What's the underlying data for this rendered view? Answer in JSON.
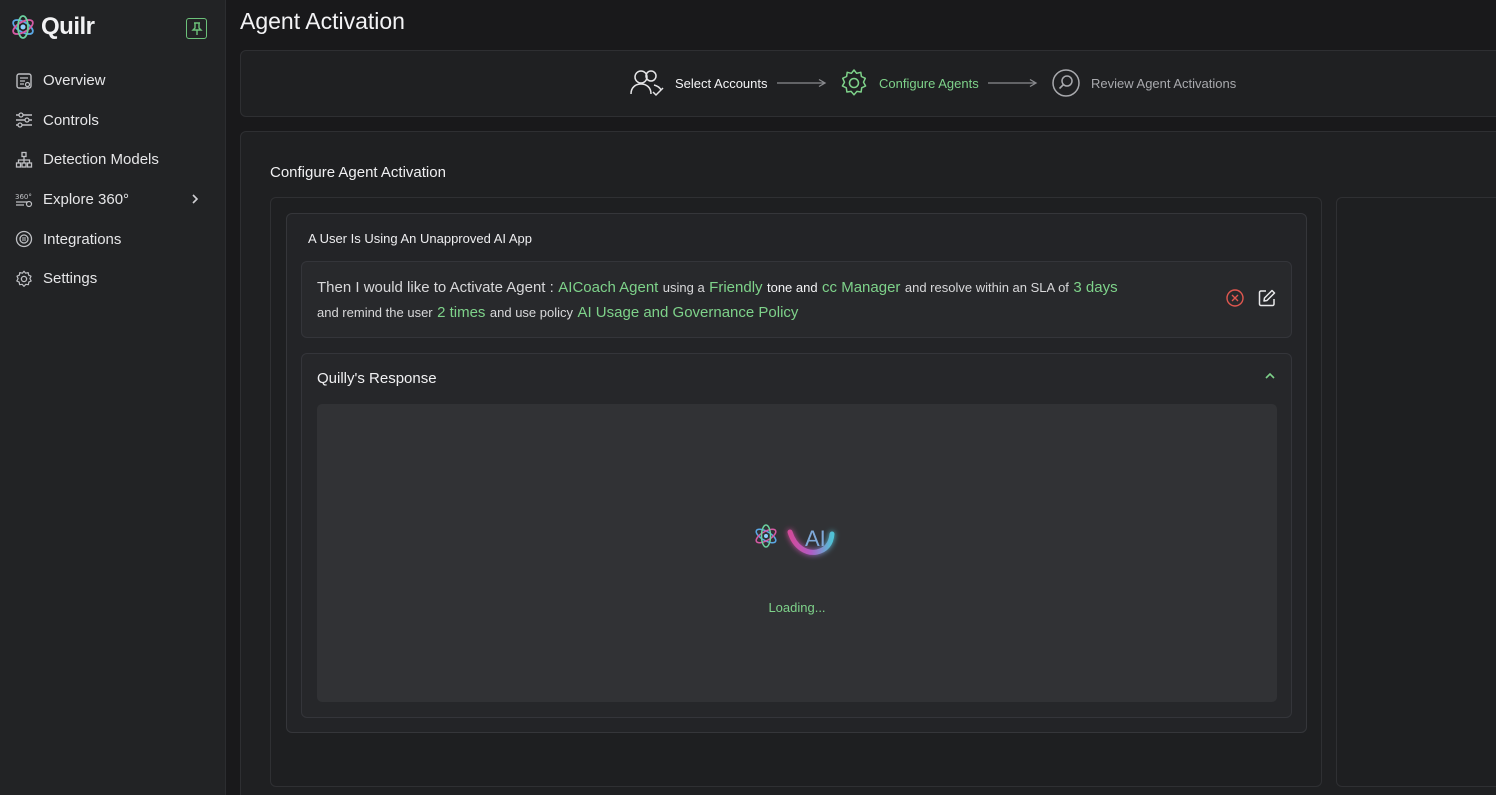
{
  "app": {
    "name": "Quilr",
    "accent": "#7ed28a"
  },
  "sidebar": {
    "items": [
      {
        "label": "Overview",
        "icon": "overview-icon"
      },
      {
        "label": "Controls",
        "icon": "sliders-icon"
      },
      {
        "label": "Detection Models",
        "icon": "hierarchy-icon"
      },
      {
        "label": "Explore 360°",
        "icon": "explore-360-icon"
      },
      {
        "label": "Integrations",
        "icon": "integrations-icon"
      },
      {
        "label": "Settings",
        "icon": "gear-icon"
      }
    ]
  },
  "page": {
    "title": "Agent Activation"
  },
  "stepper": {
    "steps": [
      {
        "label": "Select Accounts",
        "state": "completed"
      },
      {
        "label": "Configure Agents",
        "state": "active"
      },
      {
        "label": "Review Agent Activations",
        "state": "pending"
      }
    ]
  },
  "panel": {
    "title": "Configure Agent Activation",
    "scenario_title": "A User Is Using An Unapproved AI App",
    "sentence": {
      "p1": "Then I would like to Activate Agent :",
      "agent": "AICoach Agent",
      "p2": "using a",
      "tone": "Friendly",
      "p3": "tone and",
      "cc": "cc Manager",
      "p4": "and resolve within an SLA of",
      "sla": "3 days",
      "p5": "and remind the user",
      "remind": "2 times",
      "p6": "and use policy",
      "policy": "AI Usage and Governance Policy"
    },
    "response": {
      "title": "Quilly's Response",
      "loader_label": "AI",
      "loading_text": "Loading..."
    }
  }
}
